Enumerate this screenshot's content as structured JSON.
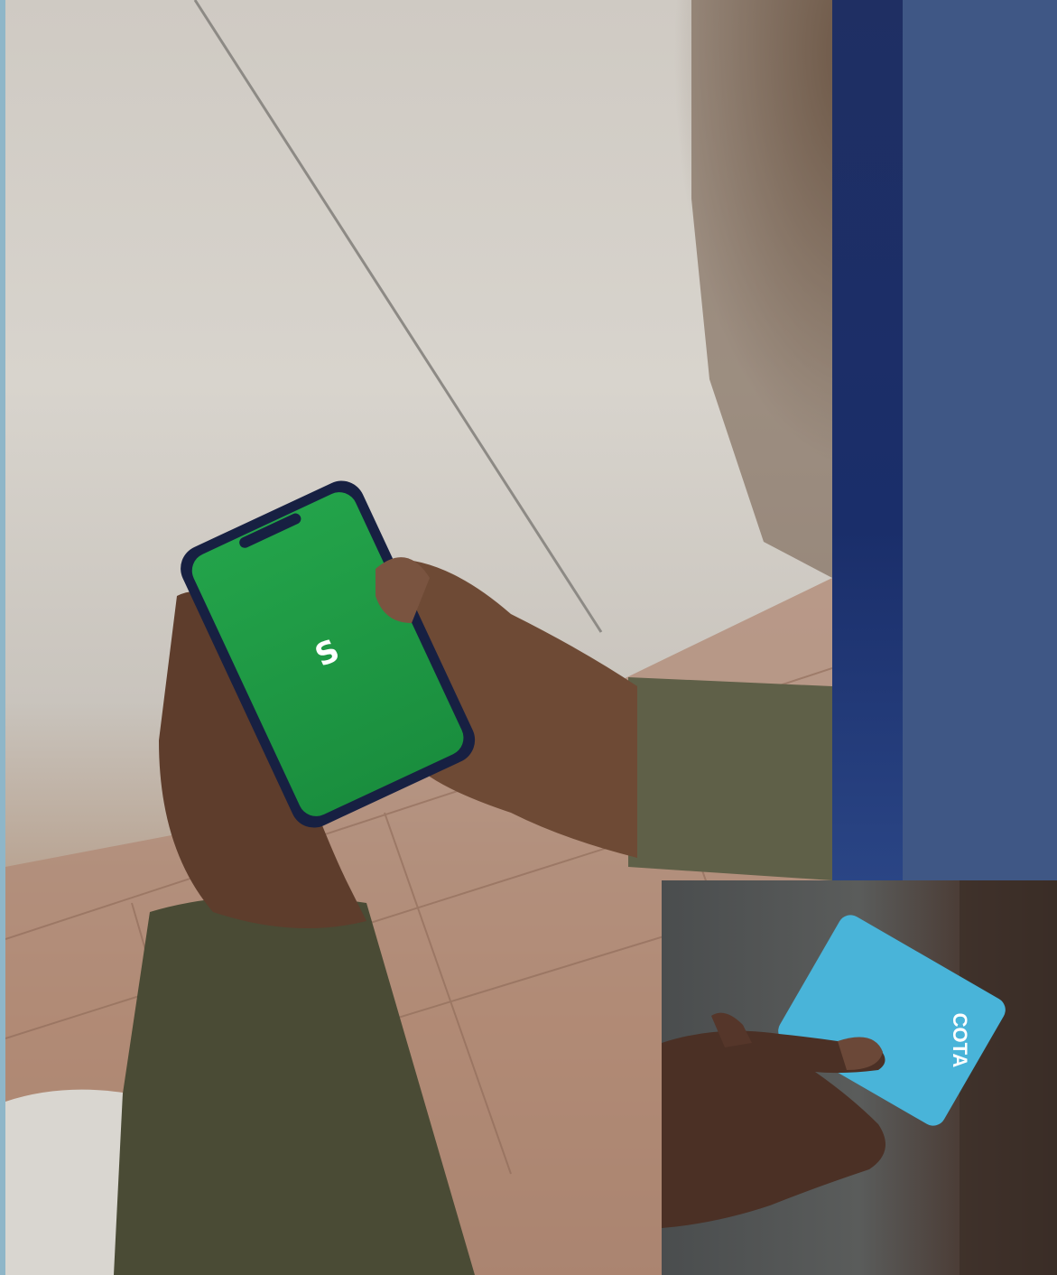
{
  "main_photo": {
    "phone_logo": "cash-app-s-icon",
    "phone_screen_color": "#1f9a45"
  },
  "inset_photo": {
    "card_brand": "COTA",
    "card_color": "#3aaed6"
  },
  "colors": {
    "panel_blue": "#3f5785",
    "dark_band": "#1d2f66",
    "edge_strip": "#8fb6c8"
  }
}
